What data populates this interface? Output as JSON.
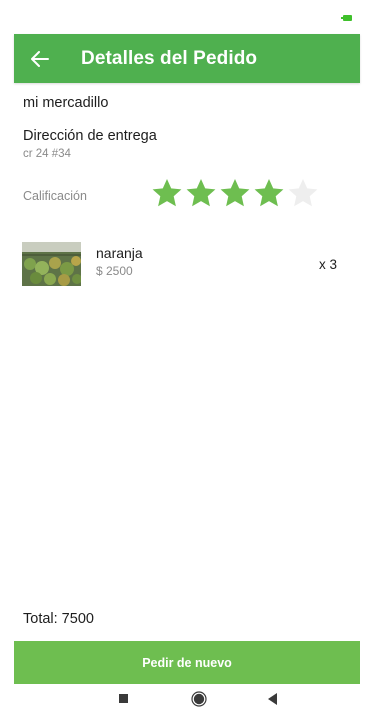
{
  "app_bar": {
    "title": "Detalles del Pedido",
    "back_icon": "arrow-left-icon"
  },
  "order": {
    "store_name": "mi mercadillo",
    "address_label": "Dirección de entrega",
    "address_value": "cr 24 #34",
    "rating_label": "Calificación",
    "rating": {
      "value": 4,
      "max": 5
    }
  },
  "items": [
    {
      "name": "naranja",
      "price": "$ 2500",
      "quantity": "x 3",
      "image_icon": "product-photo"
    }
  ],
  "total": "Total: 7500",
  "reorder_button": "Pedir de nuevo",
  "colors": {
    "primary": "#4fb04f",
    "button": "#6ebe50",
    "star_filled": "#6ebe50",
    "star_empty": "#eeeeee",
    "battery": "#3fc02b"
  },
  "system_nav": {
    "recent_icon": "square-icon",
    "home_icon": "circle-icon",
    "back_icon": "triangle-back-icon"
  }
}
